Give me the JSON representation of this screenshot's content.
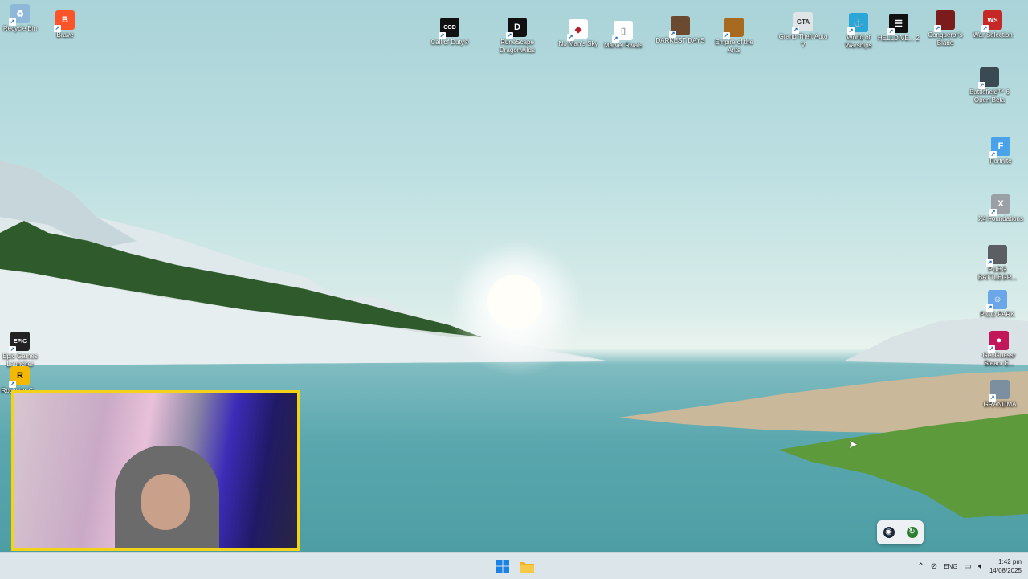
{
  "desktop_icons": {
    "recycle_bin": "Recycle Bin",
    "brave": "Brave",
    "call_of_duty": "Call of Duty®",
    "runescape": "RuneScape Dragonwilds",
    "no_mans_sky": "No Man's Sky",
    "marvel_rivals": "Marvel Rivals",
    "darkest_days": "DARKEST DAYS",
    "empire_of_the_ants": "Empire of the Ants",
    "gta_v": "Grand Theft Auto V",
    "world_of_warships": "World of Warships",
    "helldivers": "HELLDIVE... 2",
    "conquerors_blade": "Conqueror's Blade",
    "war_selection": "War Selection",
    "battlefield": "Battlefield™ 6 Open Beta",
    "fortnite": "Fortnite",
    "x4": "X4 Foundations",
    "pubg": "PUBG BATTLEGR...",
    "pico_park": "PICO PARK",
    "geoguessr": "GeoGuessr Steam E...",
    "grandma": "GRANDMA",
    "epic": "Epic Games Launcher",
    "rockstar": "Rockstar G..."
  },
  "taskbar": {
    "language": "ENG",
    "time": "1:42 pm",
    "date": "14/08/2025"
  },
  "colors": {
    "webcam_border": "#f2d318",
    "taskbar_bg": "#dce6ea"
  }
}
